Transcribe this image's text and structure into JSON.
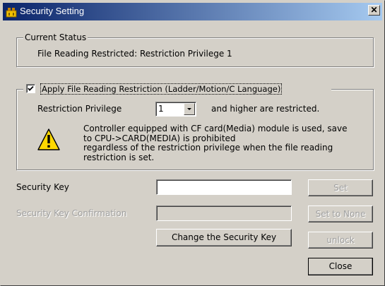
{
  "window": {
    "title": "Security Setting",
    "close_glyph": "✕"
  },
  "current_status": {
    "legend": "Current Status",
    "text": "File Reading Restricted: Restriction Privilege 1"
  },
  "restriction": {
    "checkbox_label": "Apply File Reading Restriction (Ladder/Motion/C Language)",
    "checked": true,
    "privilege_label": "Restriction Privilege",
    "privilege_value": "1",
    "privilege_suffix": "and higher are restricted.",
    "warning_lines": [
      "Controller equipped with CF card(Media) module is used, save",
      "to CPU->CARD(MEDIA) is prohibited",
      "regardless of the restriction privilege when the file reading",
      "restriction is set."
    ]
  },
  "security_key": {
    "label": "Security Key",
    "value": "",
    "confirm_label": "Security Key Confirmation",
    "confirm_value": ""
  },
  "buttons": {
    "set": "Set",
    "set_to_none": "Set to None",
    "change_key": "Change the Security Key",
    "unlock": "unlock",
    "close": "Close"
  },
  "icons": {
    "title": "app-icon",
    "warning": "warning-icon",
    "close": "close-icon",
    "dropdown": "chevron-down-icon",
    "check": "check-icon"
  },
  "colors": {
    "titlebar_start": "#0a246a",
    "titlebar_end": "#a6caf0",
    "face": "#d4d0c8",
    "warning_yellow": "#ffd800"
  }
}
